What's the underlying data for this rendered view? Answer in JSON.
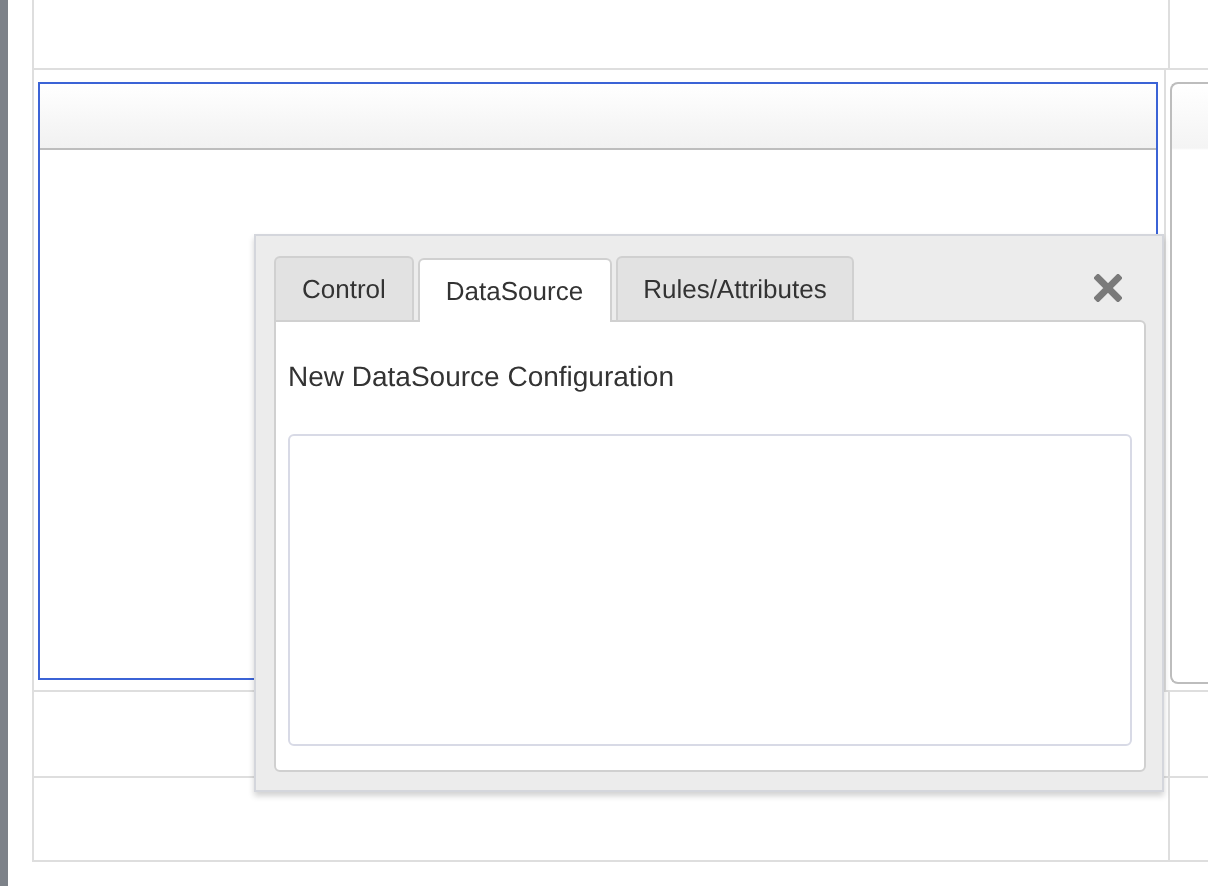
{
  "dialog": {
    "tabs": [
      {
        "label": "Control",
        "selected": false
      },
      {
        "label": "DataSource",
        "selected": true
      },
      {
        "label": "Rules/Attributes",
        "selected": false
      }
    ],
    "heading": "New DataSource Configuration"
  }
}
